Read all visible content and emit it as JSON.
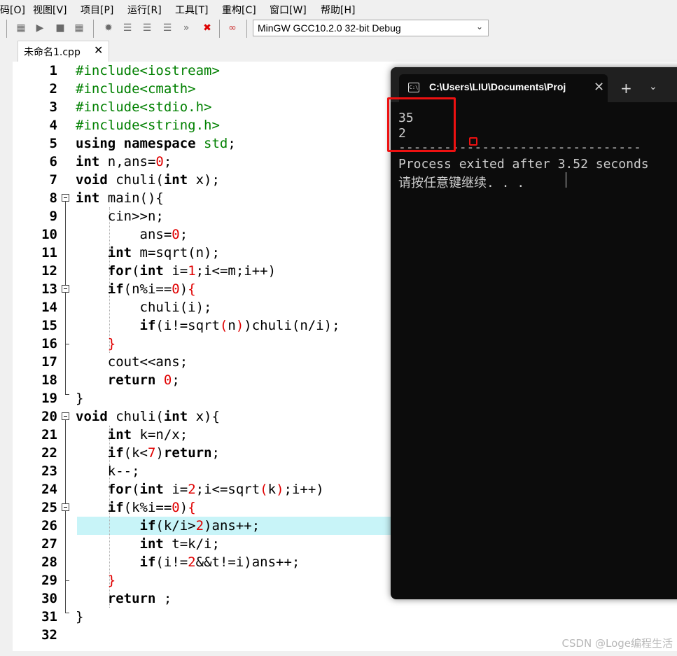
{
  "menu": {
    "items": [
      "码[O]",
      "视图[V]",
      "项目[P]",
      "运行[R]",
      "工具[T]",
      "重构[C]",
      "窗口[W]",
      "帮助[H]"
    ]
  },
  "toolbar": {
    "compiler": "MinGW GCC10.2.0 32-bit Debug",
    "icons": [
      "grid-icon",
      "run-icon",
      "stop-icon",
      "grid2-icon",
      "debug-icon",
      "step-icon",
      "step-into-icon",
      "step-out-icon",
      "continue-icon",
      "stop-debug-icon",
      "watch-icon"
    ]
  },
  "tab": {
    "filename": "未命名1.cpp",
    "close": "✕"
  },
  "editor": {
    "line_numbers": [
      "1",
      "2",
      "3",
      "4",
      "5",
      "6",
      "7",
      "8",
      "9",
      "10",
      "11",
      "12",
      "13",
      "14",
      "15",
      "16",
      "17",
      "18",
      "19",
      "20",
      "21",
      "22",
      "23",
      "24",
      "25",
      "26",
      "27",
      "28",
      "29",
      "30",
      "31",
      "32"
    ],
    "highlighted_line": 26
  },
  "terminal": {
    "title": "C:\\Users\\LIU\\Documents\\Proj",
    "output_lines": [
      "35",
      "2",
      "--------------------------------",
      "Process exited after 3.52 seconds",
      "请按任意键继续. . ."
    ],
    "add_tab": "+",
    "dropdown": "⌄"
  },
  "watermark": "CSDN @Loge编程生活"
}
